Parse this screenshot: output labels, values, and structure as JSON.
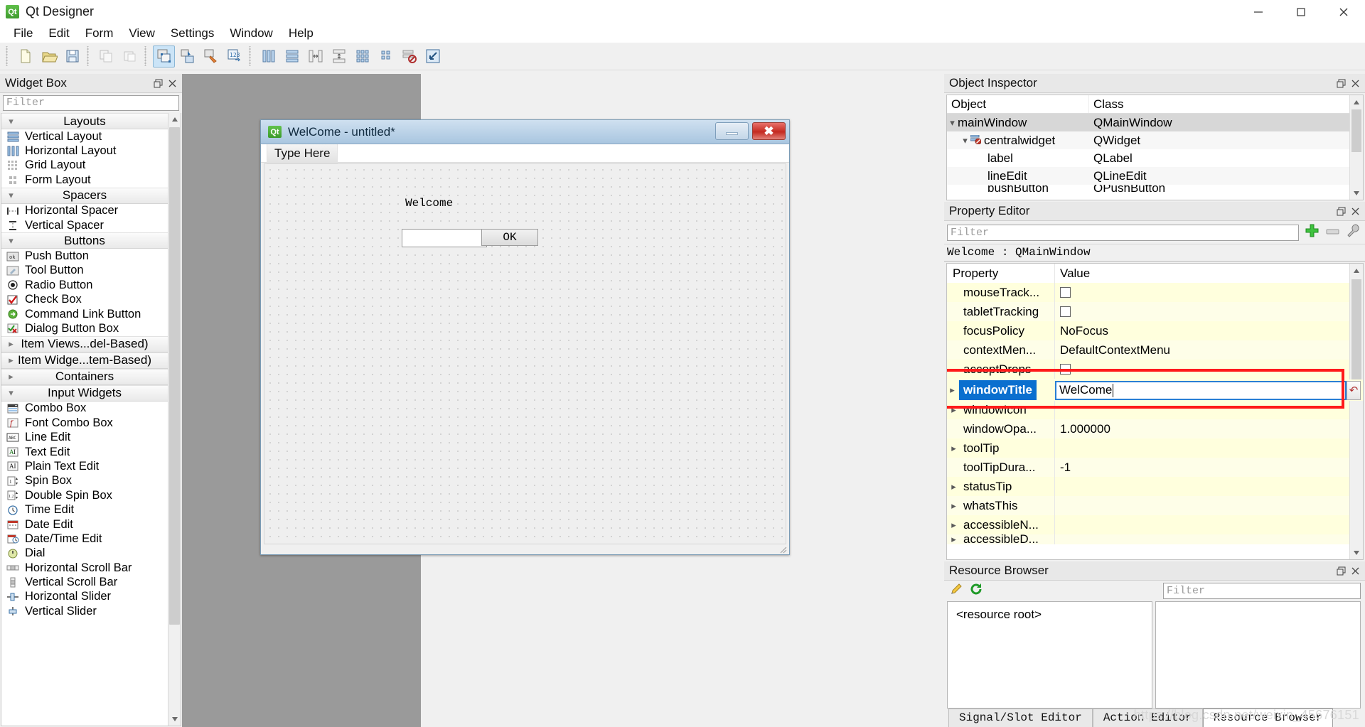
{
  "window": {
    "title": "Qt Designer",
    "app_icon": "qt-icon",
    "controls": [
      {
        "name": "minimize-button",
        "glyph": "minimize-icon"
      },
      {
        "name": "maximize-button",
        "glyph": "maximize-icon"
      },
      {
        "name": "close-button",
        "glyph": "close-icon"
      }
    ]
  },
  "menubar": {
    "items": [
      {
        "label": "File"
      },
      {
        "label": "Edit"
      },
      {
        "label": "Form"
      },
      {
        "label": "View"
      },
      {
        "label": "Settings"
      },
      {
        "label": "Window"
      },
      {
        "label": "Help"
      }
    ]
  },
  "toolbar": {
    "groups": [
      {
        "buttons": [
          {
            "name": "new-form-button",
            "icon": "new-file-icon",
            "active": false
          },
          {
            "name": "open-form-button",
            "icon": "open-folder-icon",
            "active": false
          },
          {
            "name": "save-form-button",
            "icon": "save-disk-icon",
            "active": false
          }
        ]
      },
      {
        "buttons": [
          {
            "name": "undo-button",
            "icon": "undo-icon",
            "active": false
          },
          {
            "name": "redo-button",
            "icon": "redo-icon",
            "active": false
          }
        ]
      },
      {
        "buttons": [
          {
            "name": "edit-widgets-button",
            "icon": "edit-widgets-icon",
            "active": true
          },
          {
            "name": "edit-signals-slots-button",
            "icon": "signals-slots-icon",
            "active": false
          },
          {
            "name": "edit-buddies-button",
            "icon": "buddies-icon",
            "active": false
          },
          {
            "name": "edit-tab-order-button",
            "icon": "tab-order-icon",
            "active": false
          }
        ]
      },
      {
        "buttons": [
          {
            "name": "layout-horizontally-button",
            "icon": "layout-horizontal-icon",
            "active": false
          },
          {
            "name": "layout-vertically-button",
            "icon": "layout-vertical-icon",
            "active": false
          },
          {
            "name": "layout-splitter-horizontal-button",
            "icon": "splitter-horizontal-icon",
            "active": false
          },
          {
            "name": "layout-splitter-vertical-button",
            "icon": "splitter-vertical-icon",
            "active": false
          },
          {
            "name": "layout-grid-button",
            "icon": "layout-grid-icon",
            "active": false
          },
          {
            "name": "layout-form-button",
            "icon": "layout-form-icon",
            "active": false
          },
          {
            "name": "break-layout-button",
            "icon": "break-layout-icon",
            "active": false
          },
          {
            "name": "adjust-size-button",
            "icon": "adjust-size-icon",
            "active": false
          }
        ]
      }
    ]
  },
  "widget_box": {
    "title": "Widget Box",
    "filter_placeholder": "Filter",
    "float_button": "restore-icon",
    "close_button": "close-icon",
    "categories": [
      {
        "label": "Layouts",
        "expanded": true,
        "chevron": "chevron-down-icon",
        "items": [
          {
            "label": "Vertical Layout",
            "icon": "vertical-layout-icon"
          },
          {
            "label": "Horizontal Layout",
            "icon": "horizontal-layout-icon"
          },
          {
            "label": "Grid Layout",
            "icon": "grid-layout-icon"
          },
          {
            "label": "Form Layout",
            "icon": "form-layout-icon"
          }
        ]
      },
      {
        "label": "Spacers",
        "expanded": true,
        "chevron": "chevron-down-icon",
        "items": [
          {
            "label": "Horizontal Spacer",
            "icon": "horizontal-spacer-icon"
          },
          {
            "label": "Vertical Spacer",
            "icon": "vertical-spacer-icon"
          }
        ]
      },
      {
        "label": "Buttons",
        "expanded": true,
        "chevron": "chevron-down-icon",
        "items": [
          {
            "label": "Push Button",
            "icon": "push-button-icon"
          },
          {
            "label": "Tool Button",
            "icon": "tool-button-icon"
          },
          {
            "label": "Radio Button",
            "icon": "radio-button-icon"
          },
          {
            "label": "Check Box",
            "icon": "check-box-icon"
          },
          {
            "label": "Command Link Button",
            "icon": "command-link-icon"
          },
          {
            "label": "Dialog Button Box",
            "icon": "dialog-button-box-icon"
          }
        ]
      },
      {
        "label": "Item Views...del-Based)",
        "expanded": false,
        "chevron": "chevron-right-icon",
        "items": []
      },
      {
        "label": "Item Widge...tem-Based)",
        "expanded": false,
        "chevron": "chevron-right-icon",
        "items": []
      },
      {
        "label": "Containers",
        "expanded": false,
        "chevron": "chevron-right-icon",
        "items": []
      },
      {
        "label": "Input Widgets",
        "expanded": true,
        "chevron": "chevron-down-icon",
        "items": [
          {
            "label": "Combo Box",
            "icon": "combo-box-icon"
          },
          {
            "label": "Font Combo Box",
            "icon": "font-combo-box-icon"
          },
          {
            "label": "Line Edit",
            "icon": "line-edit-icon"
          },
          {
            "label": "Text Edit",
            "icon": "text-edit-icon"
          },
          {
            "label": "Plain Text Edit",
            "icon": "plain-text-edit-icon"
          },
          {
            "label": "Spin Box",
            "icon": "spin-box-icon"
          },
          {
            "label": "Double Spin Box",
            "icon": "double-spin-box-icon"
          },
          {
            "label": "Time Edit",
            "icon": "time-edit-icon"
          },
          {
            "label": "Date Edit",
            "icon": "date-edit-icon"
          },
          {
            "label": "Date/Time Edit",
            "icon": "date-time-edit-icon"
          },
          {
            "label": "Dial",
            "icon": "dial-icon"
          },
          {
            "label": "Horizontal Scroll Bar",
            "icon": "horizontal-scroll-bar-icon"
          },
          {
            "label": "Vertical Scroll Bar",
            "icon": "vertical-scroll-bar-icon"
          },
          {
            "label": "Horizontal Slider",
            "icon": "horizontal-slider-icon"
          },
          {
            "label": "Vertical Slider",
            "icon": "vertical-slider-icon"
          }
        ]
      }
    ]
  },
  "form": {
    "title": "WelCome - untitled*",
    "icon": "qt-icon",
    "minimize_label": "minimize-icon",
    "close_label": "✖",
    "menu_placeholder": "Type Here",
    "widgets": {
      "label_text": "Welcome",
      "line_edit_value": "",
      "button_text": "OK"
    }
  },
  "object_inspector": {
    "title": "Object Inspector",
    "columns": [
      "Object",
      "Class"
    ],
    "rows": [
      {
        "object": "mainWindow",
        "class": "QMainWindow",
        "depth": 0,
        "chevron": "chevron-down-icon",
        "selected": true,
        "icon": ""
      },
      {
        "object": "centralwidget",
        "class": "QWidget",
        "depth": 1,
        "chevron": "chevron-down-icon",
        "selected": false,
        "icon": "no-layout-icon"
      },
      {
        "object": "label",
        "class": "QLabel",
        "depth": 2,
        "chevron": "",
        "selected": false,
        "icon": ""
      },
      {
        "object": "lineEdit",
        "class": "QLineEdit",
        "depth": 2,
        "chevron": "",
        "selected": false,
        "icon": ""
      },
      {
        "object": "pushButton",
        "class": "QPushButton",
        "depth": 2,
        "chevron": "",
        "selected": false,
        "icon": ""
      }
    ]
  },
  "property_editor": {
    "title": "Property Editor",
    "filter_placeholder": "Filter",
    "add_button": "plus-icon",
    "remove_button": "minus-icon",
    "configure_button": "wrench-icon",
    "object_line": "Welcome : QMainWindow",
    "columns": [
      "Property",
      "Value"
    ],
    "rows": [
      {
        "property": "mouseTrack...",
        "value": "",
        "type": "checkbox",
        "checked": false,
        "chevron": ""
      },
      {
        "property": "tabletTracking",
        "value": "",
        "type": "checkbox",
        "checked": false,
        "chevron": ""
      },
      {
        "property": "focusPolicy",
        "value": "NoFocus",
        "type": "text",
        "chevron": ""
      },
      {
        "property": "contextMen...",
        "value": "DefaultContextMenu",
        "type": "text",
        "chevron": ""
      },
      {
        "property": "acceptDrops",
        "value": "",
        "type": "checkbox",
        "checked": false,
        "chevron": ""
      },
      {
        "property": "windowIcon",
        "value": "",
        "type": "text",
        "chevron": "chevron-right-icon"
      },
      {
        "property": "windowOpa...",
        "value": "1.000000",
        "type": "text",
        "chevron": ""
      },
      {
        "property": "toolTip",
        "value": "",
        "type": "text",
        "chevron": "chevron-right-icon"
      },
      {
        "property": "toolTipDura...",
        "value": "-1",
        "type": "text",
        "chevron": ""
      },
      {
        "property": "statusTip",
        "value": "",
        "type": "text",
        "chevron": "chevron-right-icon"
      },
      {
        "property": "whatsThis",
        "value": "",
        "type": "text",
        "chevron": "chevron-right-icon"
      },
      {
        "property": "accessibleN...",
        "value": "",
        "type": "text",
        "chevron": "chevron-right-icon"
      },
      {
        "property": "accessibleD...",
        "value": "",
        "type": "text",
        "chevron": "chevron-right-icon"
      }
    ],
    "editing_row": {
      "property": "windowTitle",
      "value": "WelCome",
      "chevron": "chevron-right-icon",
      "revert_button": "revert-icon",
      "highlight_color": "#ff1a1a",
      "selection_color": "#0a6fcf"
    }
  },
  "resource_browser": {
    "title": "Resource Browser",
    "edit_button": "pencil-icon",
    "reload_button": "reload-icon",
    "filter_placeholder": "Filter",
    "tree_root": "<resource root>",
    "tabs": [
      {
        "label": "Signal/Slot Editor",
        "active": false
      },
      {
        "label": "Action Editor",
        "active": false
      },
      {
        "label": "Resource Browser",
        "active": true
      }
    ]
  },
  "watermark": "https://blog.csdn.net/weixin_45676151"
}
